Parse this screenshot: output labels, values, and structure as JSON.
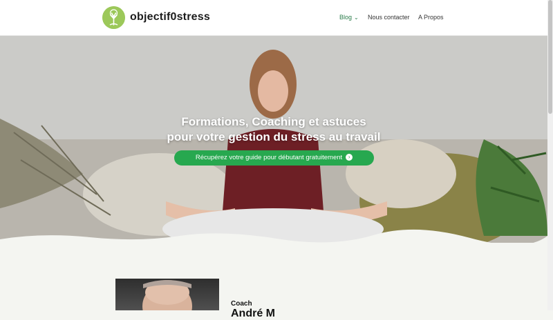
{
  "site": {
    "brand": "objectif0stress"
  },
  "nav": {
    "items": [
      {
        "label": "Blog",
        "has_dropdown": true
      },
      {
        "label": "Nous contacter"
      },
      {
        "label": "A Propos"
      }
    ]
  },
  "hero": {
    "title_line1": "Formations, Coaching et astuces",
    "title_line2": "pour votre gestion du stress au travail",
    "cta_label": "Récupérez votre guide pour débutant gratuitement",
    "cta_icon": "arrow-right-circle-icon"
  },
  "coach": {
    "label": "Coach",
    "name_partial": "André M"
  },
  "colors": {
    "accent": "#27a84f",
    "logo_green": "#9cc85a",
    "nav_active": "#2a7c4a",
    "section_bg": "#f4f5f1"
  }
}
